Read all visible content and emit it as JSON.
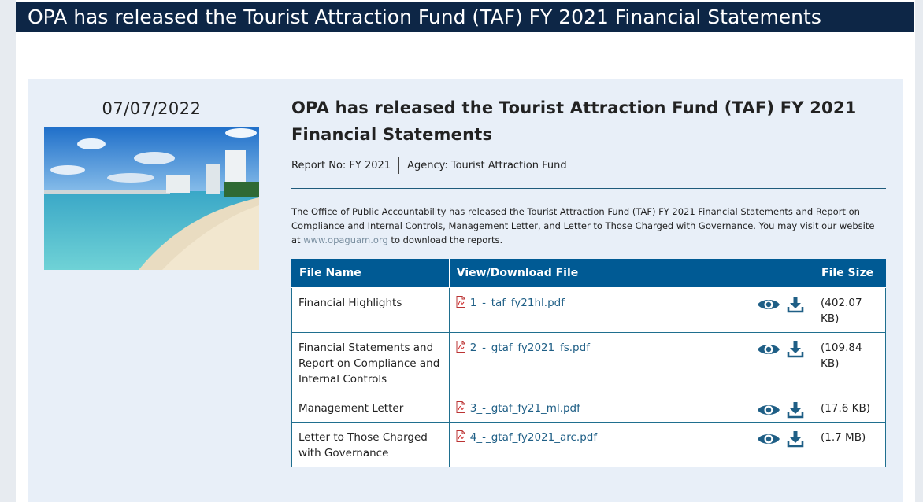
{
  "banner": {
    "title": "OPA has released the Tourist Attraction Fund (TAF) FY 2021 Financial Statements"
  },
  "post": {
    "date": "07/07/2022",
    "title": "OPA has released the Tourist Attraction Fund (TAF) FY 2021 Financial Statements",
    "report_no": "Report No: FY 2021",
    "agency": "Agency: Tourist Attraction Fund",
    "description_before": "The Office of Public Accountability has released the Tourist Attraction Fund (TAF) FY 2021 Financial Statements and Report on Compliance and Internal Controls, Management Letter, and Letter to Those Charged with Governance. You may visit our website at ",
    "description_link": "www.opaguam.org",
    "description_after": " to download the reports."
  },
  "table": {
    "headers": [
      "File Name",
      "View/Download File",
      "File Size"
    ],
    "rows": [
      {
        "name": "Financial Highlights",
        "file": "1_-_taf_fy21hl.pdf",
        "size": "(402.07 KB)"
      },
      {
        "name": "Financial Statements and Report on Compliance and Internal Controls",
        "file": "2_-_gtaf_fy2021_fs.pdf",
        "size": "(109.84 KB)"
      },
      {
        "name": "Management Letter",
        "file": "3_-_gtaf_fy21_ml.pdf",
        "size": "(17.6 KB)"
      },
      {
        "name": "Letter to Those Charged with Governance",
        "file": "4_-_gtaf_fy2021_arc.pdf",
        "size": "(1.7 MB)"
      }
    ]
  },
  "icons": {
    "pdf": "pdf-icon",
    "view": "eye-icon",
    "download": "download-icon"
  },
  "colors": {
    "banner": "#0d2646",
    "header": "#005a94",
    "link": "#1f5f86",
    "icon": "#1f5f86"
  }
}
